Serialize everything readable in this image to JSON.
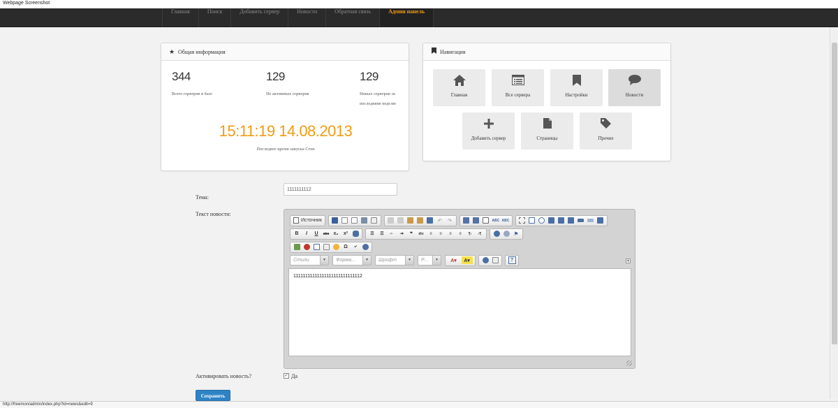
{
  "window_title": "Webpage Screenshot",
  "navbar": {
    "items": [
      {
        "label": "Главная",
        "active": false
      },
      {
        "label": "Поиск",
        "active": false
      },
      {
        "label": "Добавить сервер",
        "active": false
      },
      {
        "label": "Новости",
        "active": false
      },
      {
        "label": "Обратная связь",
        "active": false
      },
      {
        "label": "Админ панель",
        "active": true
      }
    ]
  },
  "info_panel": {
    "title": "Общая информация",
    "title_icon": "star-icon",
    "stats": [
      {
        "value": "344",
        "label": "Всего серверов в базе"
      },
      {
        "value": "129",
        "label": "Не активных серверов"
      },
      {
        "value": "129",
        "label": "Новых серверов за последнюю неделю"
      }
    ],
    "clock": "15:11:19 14.08.2013",
    "clock_label": "Последнее время запуска Cron"
  },
  "nav_panel": {
    "title": "Навигация",
    "title_icon": "bookmark-icon",
    "tiles": [
      {
        "label": "Главная",
        "icon": "home-icon"
      },
      {
        "label": "Все сервера",
        "icon": "list-icon"
      },
      {
        "label": "Настройки",
        "icon": "bookmark-icon"
      },
      {
        "label": "Новости",
        "icon": "comment-icon"
      },
      {
        "label": "Добавить сервер",
        "icon": "plus-icon"
      },
      {
        "label": "Страницы",
        "icon": "file-icon"
      },
      {
        "label": "Прочие",
        "icon": "tag-icon"
      }
    ]
  },
  "form": {
    "topic_label": "Тема:",
    "topic_value": "1111111112",
    "text_label": "Текст новости:",
    "editor": {
      "source_label": "Источник",
      "combos": {
        "styles": "Стили",
        "format": "Форма...",
        "font": "Шрифт",
        "size": "Р..."
      },
      "content": "11111111111111111111111111112"
    },
    "activate_label": "Активировать новость?",
    "activate_checkbox_label": "Да",
    "activate_checked": true,
    "save_label": "Сохранить"
  },
  "status_bar": "http://freemon/admin/index.php?id=news&edit=9",
  "colors": {
    "accent": "#f39c12",
    "navbar": "#2b2b2b",
    "primary_button": "#2f83c5"
  }
}
